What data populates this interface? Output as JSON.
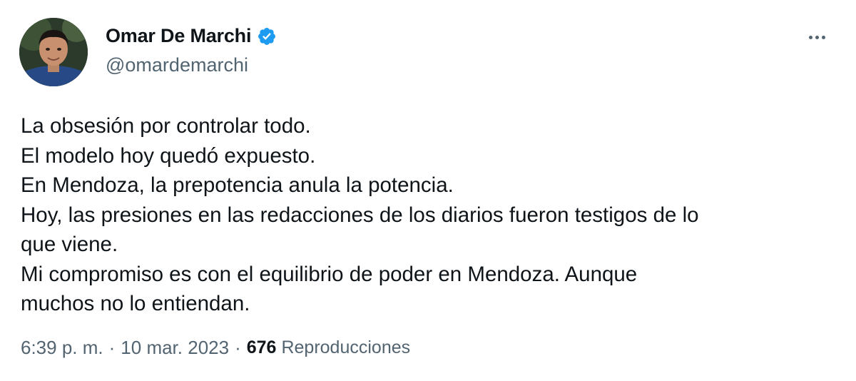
{
  "author": {
    "display_name": "Omar De Marchi",
    "handle": "@omardemarchi",
    "verified": true,
    "verified_color": "#1d9bf0"
  },
  "menu_icon": "more-horizontal-icon",
  "tweet": {
    "lines": [
      "La obsesión por controlar todo.",
      "El modelo hoy quedó expuesto.",
      "En Mendoza, la prepotencia anula la potencia.",
      "Hoy, las presiones en las redacciones de los diarios fueron testigos de lo",
      "que viene.",
      "Mi compromiso es con el equilibrio de poder en Mendoza. Aunque",
      "muchos no lo entiendan."
    ]
  },
  "meta": {
    "time": "6:39 p. m.",
    "separator": "·",
    "date": "10 mar. 2023",
    "views_count": "676",
    "views_label": "Reproducciones"
  },
  "colors": {
    "text_primary": "#0f1419",
    "text_secondary": "#536471",
    "accent": "#1d9bf0"
  }
}
